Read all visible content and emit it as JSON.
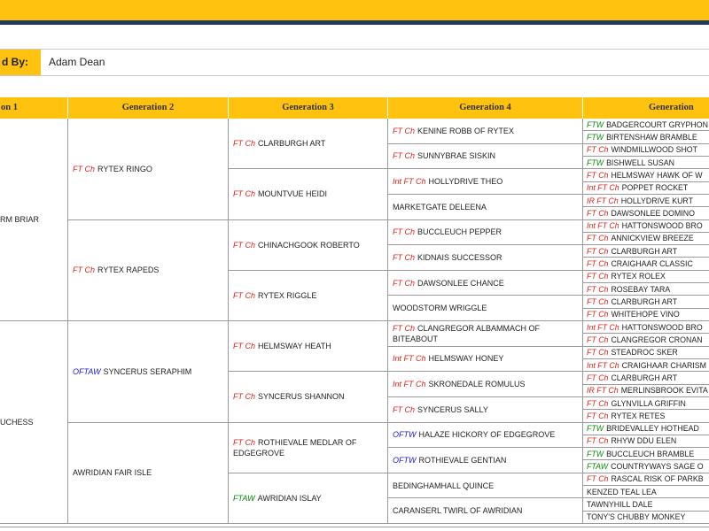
{
  "owner": {
    "label": "d By:",
    "value": "Adam Dean"
  },
  "headers": [
    "on 1",
    "Generation 2",
    "Generation 3",
    "Generation 4",
    "Generation"
  ],
  "colors": {
    "accent": "#ffc20e",
    "navy": "#1f3a5a",
    "title_red": "#e2231a",
    "title_green": "#0a8a0a",
    "title_blue": "#1a1ad8"
  },
  "gen1": [
    {
      "title": "",
      "name": "RM BRIAR"
    },
    {
      "title": "",
      "name": "UCHESS"
    }
  ],
  "gen2": [
    {
      "title": "FT Ch",
      "name": "RYTEX RINGO"
    },
    {
      "title": "FT Ch",
      "name": "RYTEX RAPEDS"
    },
    {
      "title": "OFTAW",
      "name": "SYNCERUS SERAPHIM"
    },
    {
      "title": "",
      "name": "AWRIDIAN FAIR ISLE"
    }
  ],
  "gen3": [
    {
      "title": "FT Ch",
      "name": "CLARBURGH ART"
    },
    {
      "title": "FT Ch",
      "name": "MOUNTVUE HEIDI"
    },
    {
      "title": "FT Ch",
      "name": "CHINACHGOOK ROBERTO"
    },
    {
      "title": "FT Ch",
      "name": "RYTEX RIGGLE"
    },
    {
      "title": "FT Ch",
      "name": "HELMSWAY HEATH"
    },
    {
      "title": "FT Ch",
      "name": "SYNCERUS SHANNON"
    },
    {
      "title": "FT Ch",
      "name": "ROTHIEVALE MEDLAR OF EDGEGROVE"
    },
    {
      "title": "FTAW",
      "name": "AWRIDIAN ISLAY"
    }
  ],
  "gen4": [
    {
      "title": "FT Ch",
      "name": "KENINE ROBB OF RYTEX"
    },
    {
      "title": "FT Ch",
      "name": "SUNNYBRAE SISKIN"
    },
    {
      "title": "Int FT Ch",
      "name": "HOLLYDRIVE THEO"
    },
    {
      "title": "",
      "name": "MARKETGATE DELEENA"
    },
    {
      "title": "FT Ch",
      "name": "BUCCLEUCH PEPPER"
    },
    {
      "title": "FT Ch",
      "name": "KIDNAIS SUCCESSOR"
    },
    {
      "title": "FT Ch",
      "name": "DAWSONLEE CHANCE"
    },
    {
      "title": "",
      "name": "WOODSTORM WRIGGLE"
    },
    {
      "title": "FT Ch",
      "name": "CLANGREGOR ALBAMMACH OF BITEABOUT"
    },
    {
      "title": "Int FT Ch",
      "name": "HELMSWAY HONEY"
    },
    {
      "title": "Int FT Ch",
      "name": "SKRONEDALE ROMULUS"
    },
    {
      "title": "FT Ch",
      "name": "SYNCERUS SALLY"
    },
    {
      "title": "OFTW",
      "name": "HALAZE HICKORY OF EDGEGROVE"
    },
    {
      "title": "OFTW",
      "name": "ROTHIEVALE GENTIAN"
    },
    {
      "title": "",
      "name": "BEDINGHAMHALL QUINCE"
    },
    {
      "title": "",
      "name": "CARANSERL TWIRL OF AWRIDIAN"
    }
  ],
  "gen5": [
    {
      "title": "FTW",
      "name": "BADGERCOURT GRYPHON"
    },
    {
      "title": "FTW",
      "name": "BIRTENSHAW BRAMBLE"
    },
    {
      "title": "FT Ch",
      "name": "WINDMILLWOOD SHOT"
    },
    {
      "title": "FTW",
      "name": "BISHWELL SUSAN"
    },
    {
      "title": "FT Ch",
      "name": "HELMSWAY HAWK OF W"
    },
    {
      "title": "Int FT Ch",
      "name": "POPPET ROCKET"
    },
    {
      "title": "IR FT Ch",
      "name": "HOLLYDRIVE KURT"
    },
    {
      "title": "FT Ch",
      "name": "DAWSONLEE DOMINO"
    },
    {
      "title": "Int FT Ch",
      "name": "HATTONSWOOD BRO"
    },
    {
      "title": "FT Ch",
      "name": "ANNICKVIEW BREEZE"
    },
    {
      "title": "FT Ch",
      "name": "CLARBURGH ART"
    },
    {
      "title": "FT Ch",
      "name": "CRAIGHAAR CLASSIC"
    },
    {
      "title": "FT Ch",
      "name": "RYTEX ROLEX"
    },
    {
      "title": "FT Ch",
      "name": "ROSEBAY TARA"
    },
    {
      "title": "FT Ch",
      "name": "CLARBURGH ART"
    },
    {
      "title": "FT Ch",
      "name": "WHITEHOPE VINO"
    },
    {
      "title": "Int FT Ch",
      "name": "HATTONSWOOD BRO"
    },
    {
      "title": "FT Ch",
      "name": "CLANGREGOR CRONAN"
    },
    {
      "title": "FT Ch",
      "name": "STEADROC SKER"
    },
    {
      "title": "Int FT Ch",
      "name": "CRAIGHAAR CHARISM"
    },
    {
      "title": "FT Ch",
      "name": "CLARBURGH ART"
    },
    {
      "title": "IR FT Ch",
      "name": "MERLINSBROOK EVITA"
    },
    {
      "title": "FT Ch",
      "name": "GLYNVILLA GRIFFIN"
    },
    {
      "title": "FT Ch",
      "name": "RYTEX RETES"
    },
    {
      "title": "FTW",
      "name": "BRIDEVALLEY HOTHEAD"
    },
    {
      "title": "FT Ch",
      "name": "RHYW DDU ELEN"
    },
    {
      "title": "FTW",
      "name": "BUCCLEUCH BRAMBLE"
    },
    {
      "title": "FTAW",
      "name": "COUNTRYWAYS SAGE O"
    },
    {
      "title": "FT Ch",
      "name": "RASCAL RISK OF PARKB"
    },
    {
      "title": "",
      "name": "KENZED TEAL LEA"
    },
    {
      "title": "",
      "name": "TAWNYHILL DALE"
    },
    {
      "title": "",
      "name": "TONY'S CHUBBY MONKEY"
    }
  ]
}
